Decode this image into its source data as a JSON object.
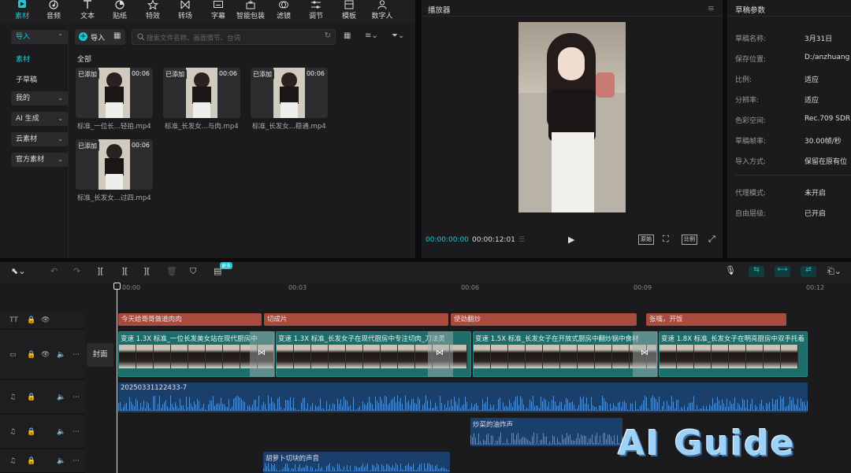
{
  "toolbar": {
    "items": [
      {
        "label": "素材",
        "icon": "media-icon",
        "active": true
      },
      {
        "label": "音频",
        "icon": "audio-icon"
      },
      {
        "label": "文本",
        "icon": "text-icon"
      },
      {
        "label": "贴纸",
        "icon": "sticker-icon"
      },
      {
        "label": "特效",
        "icon": "effects-icon"
      },
      {
        "label": "转场",
        "icon": "transition-icon"
      },
      {
        "label": "字幕",
        "icon": "subtitle-icon"
      },
      {
        "label": "智能包装",
        "icon": "smart-pack-icon"
      },
      {
        "label": "滤镜",
        "icon": "filter-icon"
      },
      {
        "label": "调节",
        "icon": "adjust-icon"
      },
      {
        "label": "模板",
        "icon": "template-icon"
      },
      {
        "label": "数字人",
        "icon": "digital-human-icon"
      }
    ]
  },
  "sidebar": {
    "import": "导入",
    "media": "素材",
    "sub_draft": "子草稿",
    "mine": "我的",
    "ai_gen": "AI 生成",
    "cloud": "云素材",
    "official": "官方素材"
  },
  "media_panel": {
    "import_button": "导入",
    "search_placeholder": "搜索文件名称、画面情节、台词",
    "section": "全部",
    "items": [
      {
        "tag": "已添加",
        "duration": "00:06",
        "name": "标准_一位长...轻拍.mp4"
      },
      {
        "tag": "已添加",
        "duration": "00:06",
        "name": "标准_长发女...与肉.mp4"
      },
      {
        "tag": "已添加",
        "duration": "00:06",
        "name": "标准_长发女...稳通.mp4"
      },
      {
        "tag": "已添加",
        "duration": "00:06",
        "name": "标准_长发女...过四.mp4"
      }
    ]
  },
  "player": {
    "title": "播放器",
    "current_time": "00:00:00:00",
    "total_time": "00:00:12:01",
    "btn_original": "原始",
    "btn_ratio": "比例"
  },
  "params": {
    "title": "草稿参数",
    "rows": [
      {
        "label": "草稿名称:",
        "value": "3月31日"
      },
      {
        "label": "保存位置:",
        "value": "D:/anzhuang"
      },
      {
        "label": "比例:",
        "value": "适应"
      },
      {
        "label": "分辨率:",
        "value": "适应"
      },
      {
        "label": "色彩空间:",
        "value": "Rec.709 SDR"
      },
      {
        "label": "草稿帧率:",
        "value": "30.00帧/秒"
      },
      {
        "label": "导入方式:",
        "value": "保留在原有位"
      },
      {
        "label": "代理模式:",
        "value": "未开启"
      },
      {
        "label": "自由层级:",
        "value": "已开启"
      }
    ]
  },
  "timeline": {
    "badge_new": "更多",
    "ruler": [
      "00:00",
      "00:03",
      "00:06",
      "00:09",
      "00:12"
    ],
    "cover_button": "封面",
    "text_clips": [
      {
        "label": "今天给哥哥做道肉肉"
      },
      {
        "label": "切成片"
      },
      {
        "label": "使劲翻炒"
      },
      {
        "label": "张嘴，开饭"
      }
    ],
    "video_clips": [
      {
        "label": "变速 1.3X  标准_一位长发美女站在现代厨房中"
      },
      {
        "label": "变速 1.3X  标准_长发女子在现代厨房中专注切肉_刀法灵"
      },
      {
        "label": "变速 1.5X  标准_长发女子在开放式厨房中翻炒锅中食材"
      },
      {
        "label": "变速 1.8X  标准_长发女子在明亮厨房中双手托着"
      }
    ],
    "audio_main": "20250331122433-7",
    "audio_sfx1": "炒菜的油炸声",
    "audio_sfx2": "胡萝卜切块的声音"
  },
  "watermark": "AI Guide",
  "colors": {
    "accent": "#1fc5d4",
    "text_clip": "#a84a3e",
    "video_clip": "#1d6e6a",
    "audio_clip": "#1a3f6b"
  }
}
